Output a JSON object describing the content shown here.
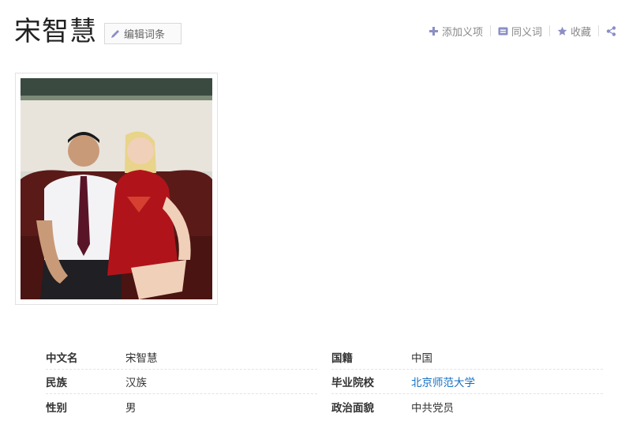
{
  "header": {
    "title": "宋智慧",
    "edit_label": "编辑词条"
  },
  "actions": [
    {
      "label": "添加义项",
      "icon": "plus-icon"
    },
    {
      "label": "同义词",
      "icon": "synonym-icon"
    },
    {
      "label": "收藏",
      "icon": "star-icon"
    }
  ],
  "info": {
    "left": [
      {
        "label": "中文名",
        "value": "宋智慧"
      },
      {
        "label": "民族",
        "value": "汉族"
      },
      {
        "label": "性别",
        "value": "男"
      }
    ],
    "right": [
      {
        "label": "国籍",
        "value": "中国"
      },
      {
        "label": "毕业院校",
        "value": "北京师范大学"
      },
      {
        "label": "政治面貌",
        "value": "中共党员"
      }
    ]
  },
  "colors": {
    "accent": "#136ec2",
    "icon": "#8b8fc4"
  }
}
